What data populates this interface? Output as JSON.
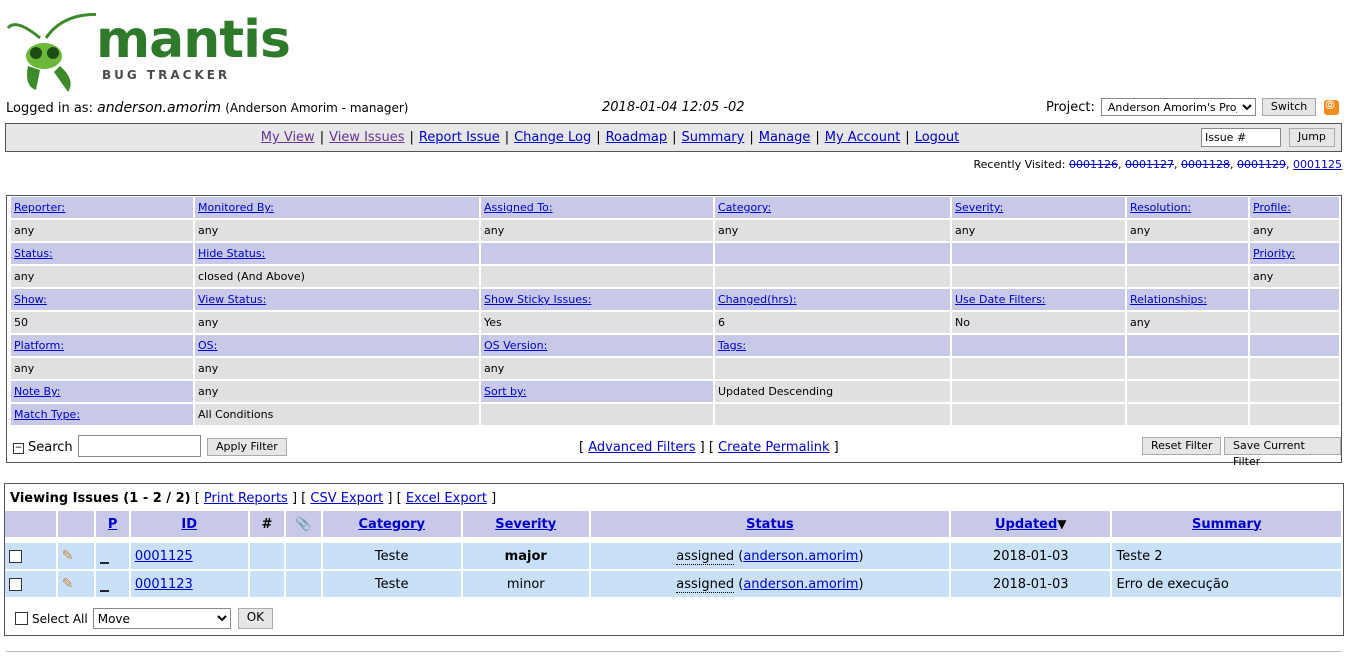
{
  "logo": {
    "title": "mantis",
    "subtitle": "BUG TRACKER"
  },
  "header": {
    "logged_in_label": "Logged in as:",
    "username": "anderson.amorim",
    "user_detail": "(Anderson Amorim - manager)",
    "datetime": "2018-01-04 12:05 -02",
    "project_label": "Project:",
    "project_value": "Anderson Amorim's Project",
    "switch_label": "Switch"
  },
  "menu": {
    "items": [
      "My View",
      "View Issues",
      "Report Issue",
      "Change Log",
      "Roadmap",
      "Summary",
      "Manage",
      "My Account",
      "Logout"
    ],
    "jump_placeholder": "Issue #",
    "jump_label": "Jump"
  },
  "recent": {
    "label": "Recently Visited:",
    "items": [
      "0001126",
      "0001127",
      "0001128",
      "0001129",
      "0001125"
    ]
  },
  "filters": {
    "rows": [
      {
        "type": "hdr",
        "cells": [
          "Reporter:",
          "Monitored By:",
          "Assigned To:",
          "Category:",
          "Severity:",
          "Resolution:",
          "Profile:"
        ]
      },
      {
        "type": "val",
        "cells": [
          "any",
          "any",
          "any",
          "any",
          "any",
          "any",
          "any"
        ]
      },
      {
        "type": "hdr",
        "cells": [
          "Status:",
          "Hide Status:",
          "",
          "",
          "",
          "",
          "Priority:"
        ]
      },
      {
        "type": "val",
        "cells": [
          "any",
          "closed (And Above)",
          "",
          "",
          "",
          "",
          "any"
        ]
      },
      {
        "type": "hdr",
        "cells": [
          "Show:",
          "View Status:",
          "Show Sticky Issues:",
          "Changed(hrs):",
          "Use Date Filters:",
          "Relationships:",
          ""
        ]
      },
      {
        "type": "val",
        "cells": [
          "50",
          "any",
          "Yes",
          "6",
          "No",
          "any",
          ""
        ]
      },
      {
        "type": "hdr",
        "cells": [
          "Platform:",
          "OS:",
          "OS Version:",
          "Tags:",
          "",
          "",
          ""
        ]
      },
      {
        "type": "val",
        "cells": [
          "any",
          "any",
          "any",
          "",
          "",
          "",
          ""
        ]
      },
      {
        "type": "hdr",
        "cells": [
          "Note By:",
          "any",
          "Sort by:",
          "Updated Descending",
          "",
          "",
          ""
        ]
      },
      {
        "type": "hdr",
        "cells": [
          "Match Type:",
          "All Conditions",
          "",
          "",
          "",
          "",
          ""
        ]
      }
    ],
    "search_label": "Search",
    "apply_label": "Apply Filter",
    "advanced_label": "Advanced Filters",
    "permalink_label": "Create Permalink",
    "reset_label": "Reset Filter",
    "save_label": "Save Current Filter"
  },
  "issues": {
    "caption": "Viewing Issues (1 - 2 / 2)",
    "print_label": "Print Reports",
    "csv_label": "CSV Export",
    "excel_label": "Excel Export",
    "columns": [
      "P",
      "ID",
      "#",
      "Category",
      "Severity",
      "Status",
      "Updated",
      "Summary"
    ],
    "rows": [
      {
        "id": "0001125",
        "category": "Teste",
        "severity": "major",
        "status": "assigned",
        "handler": "anderson.amorim",
        "updated": "2018-01-03",
        "summary": "Teste 2"
      },
      {
        "id": "0001123",
        "category": "Teste",
        "severity": "minor",
        "status": "assigned",
        "handler": "anderson.amorim",
        "updated": "2018-01-03",
        "summary": "Erro de execução"
      }
    ],
    "select_all_label": "Select All",
    "action_value": "Move",
    "ok_label": "OK"
  }
}
